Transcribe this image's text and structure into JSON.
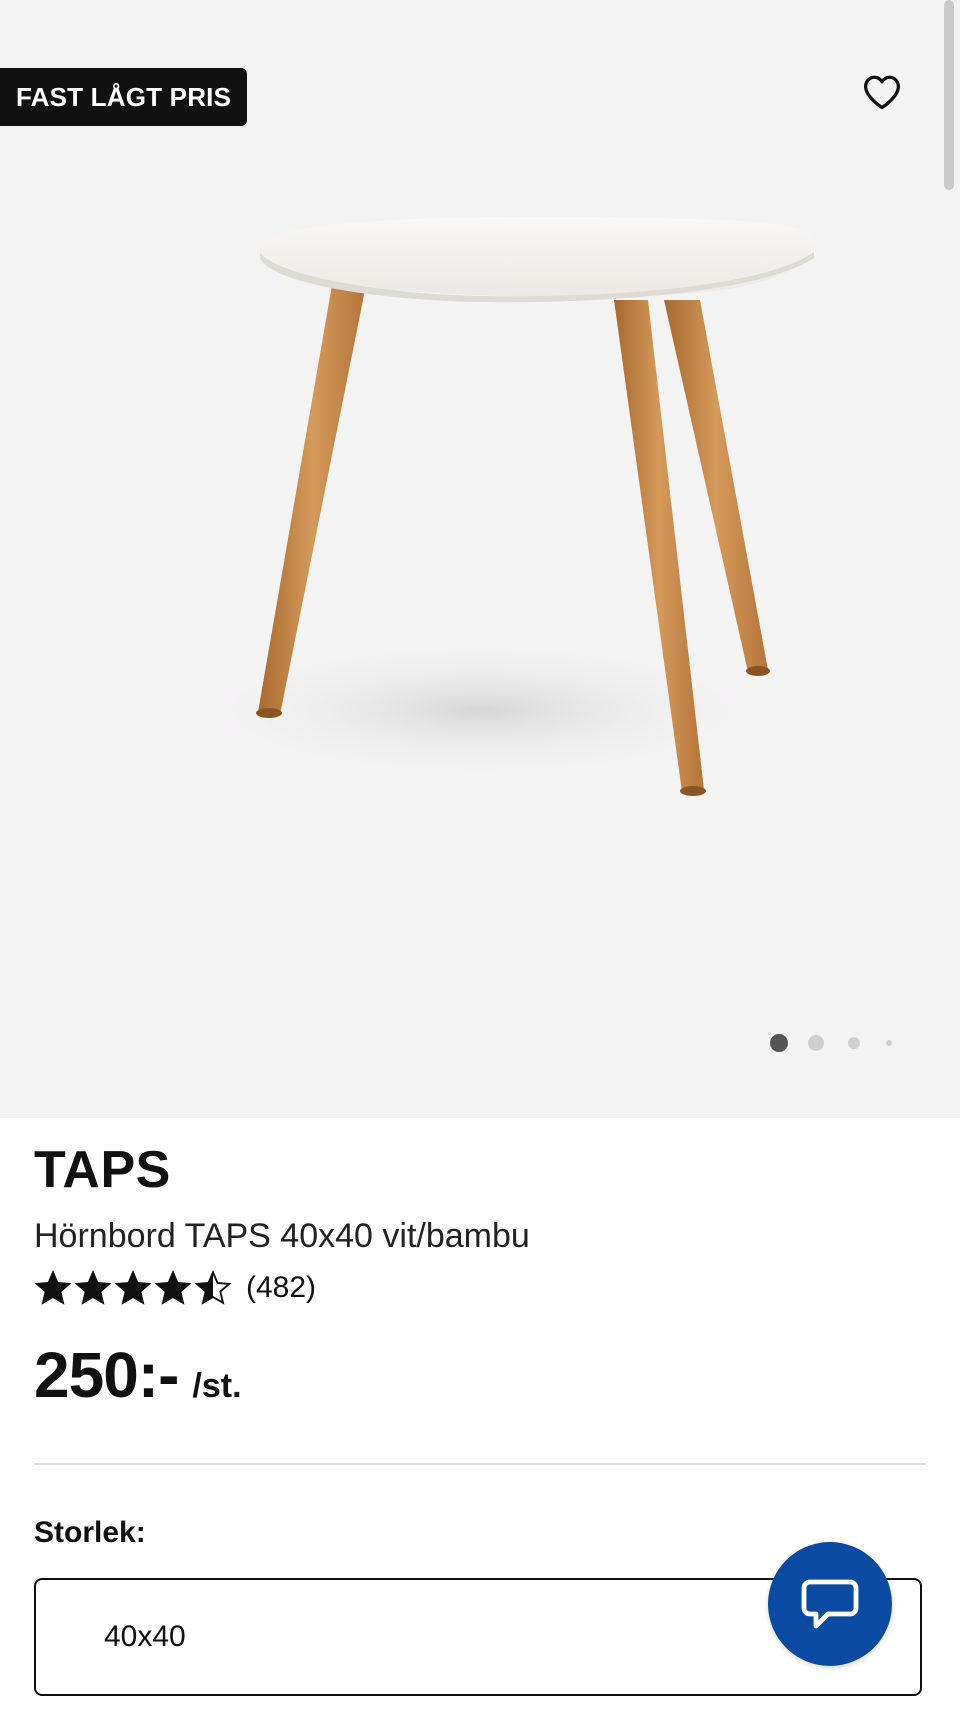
{
  "badge": {
    "label": "FAST LÅGT PRIS"
  },
  "product": {
    "brand": "TAPS",
    "description": "Hörnbord TAPS 40x40 vit/bambu",
    "rating": {
      "stars": 4.5,
      "max_stars": 5,
      "review_count": "(482)"
    },
    "price": "250:-",
    "unit": "/st."
  },
  "gallery": {
    "image_count": 4,
    "active_index": 0
  },
  "size": {
    "label": "Storlek:",
    "selected": "40x40"
  },
  "icons": {
    "favorite": "heart-outline-icon",
    "chat": "chat-bubble-icon",
    "star": "star-icon"
  },
  "colors": {
    "hero_bg": "#f4f3f4",
    "badge_bg": "#111111",
    "chat_button": "#0a4aa3",
    "active_dot": "#555555",
    "inactive_dot": "#cfcfcf"
  }
}
